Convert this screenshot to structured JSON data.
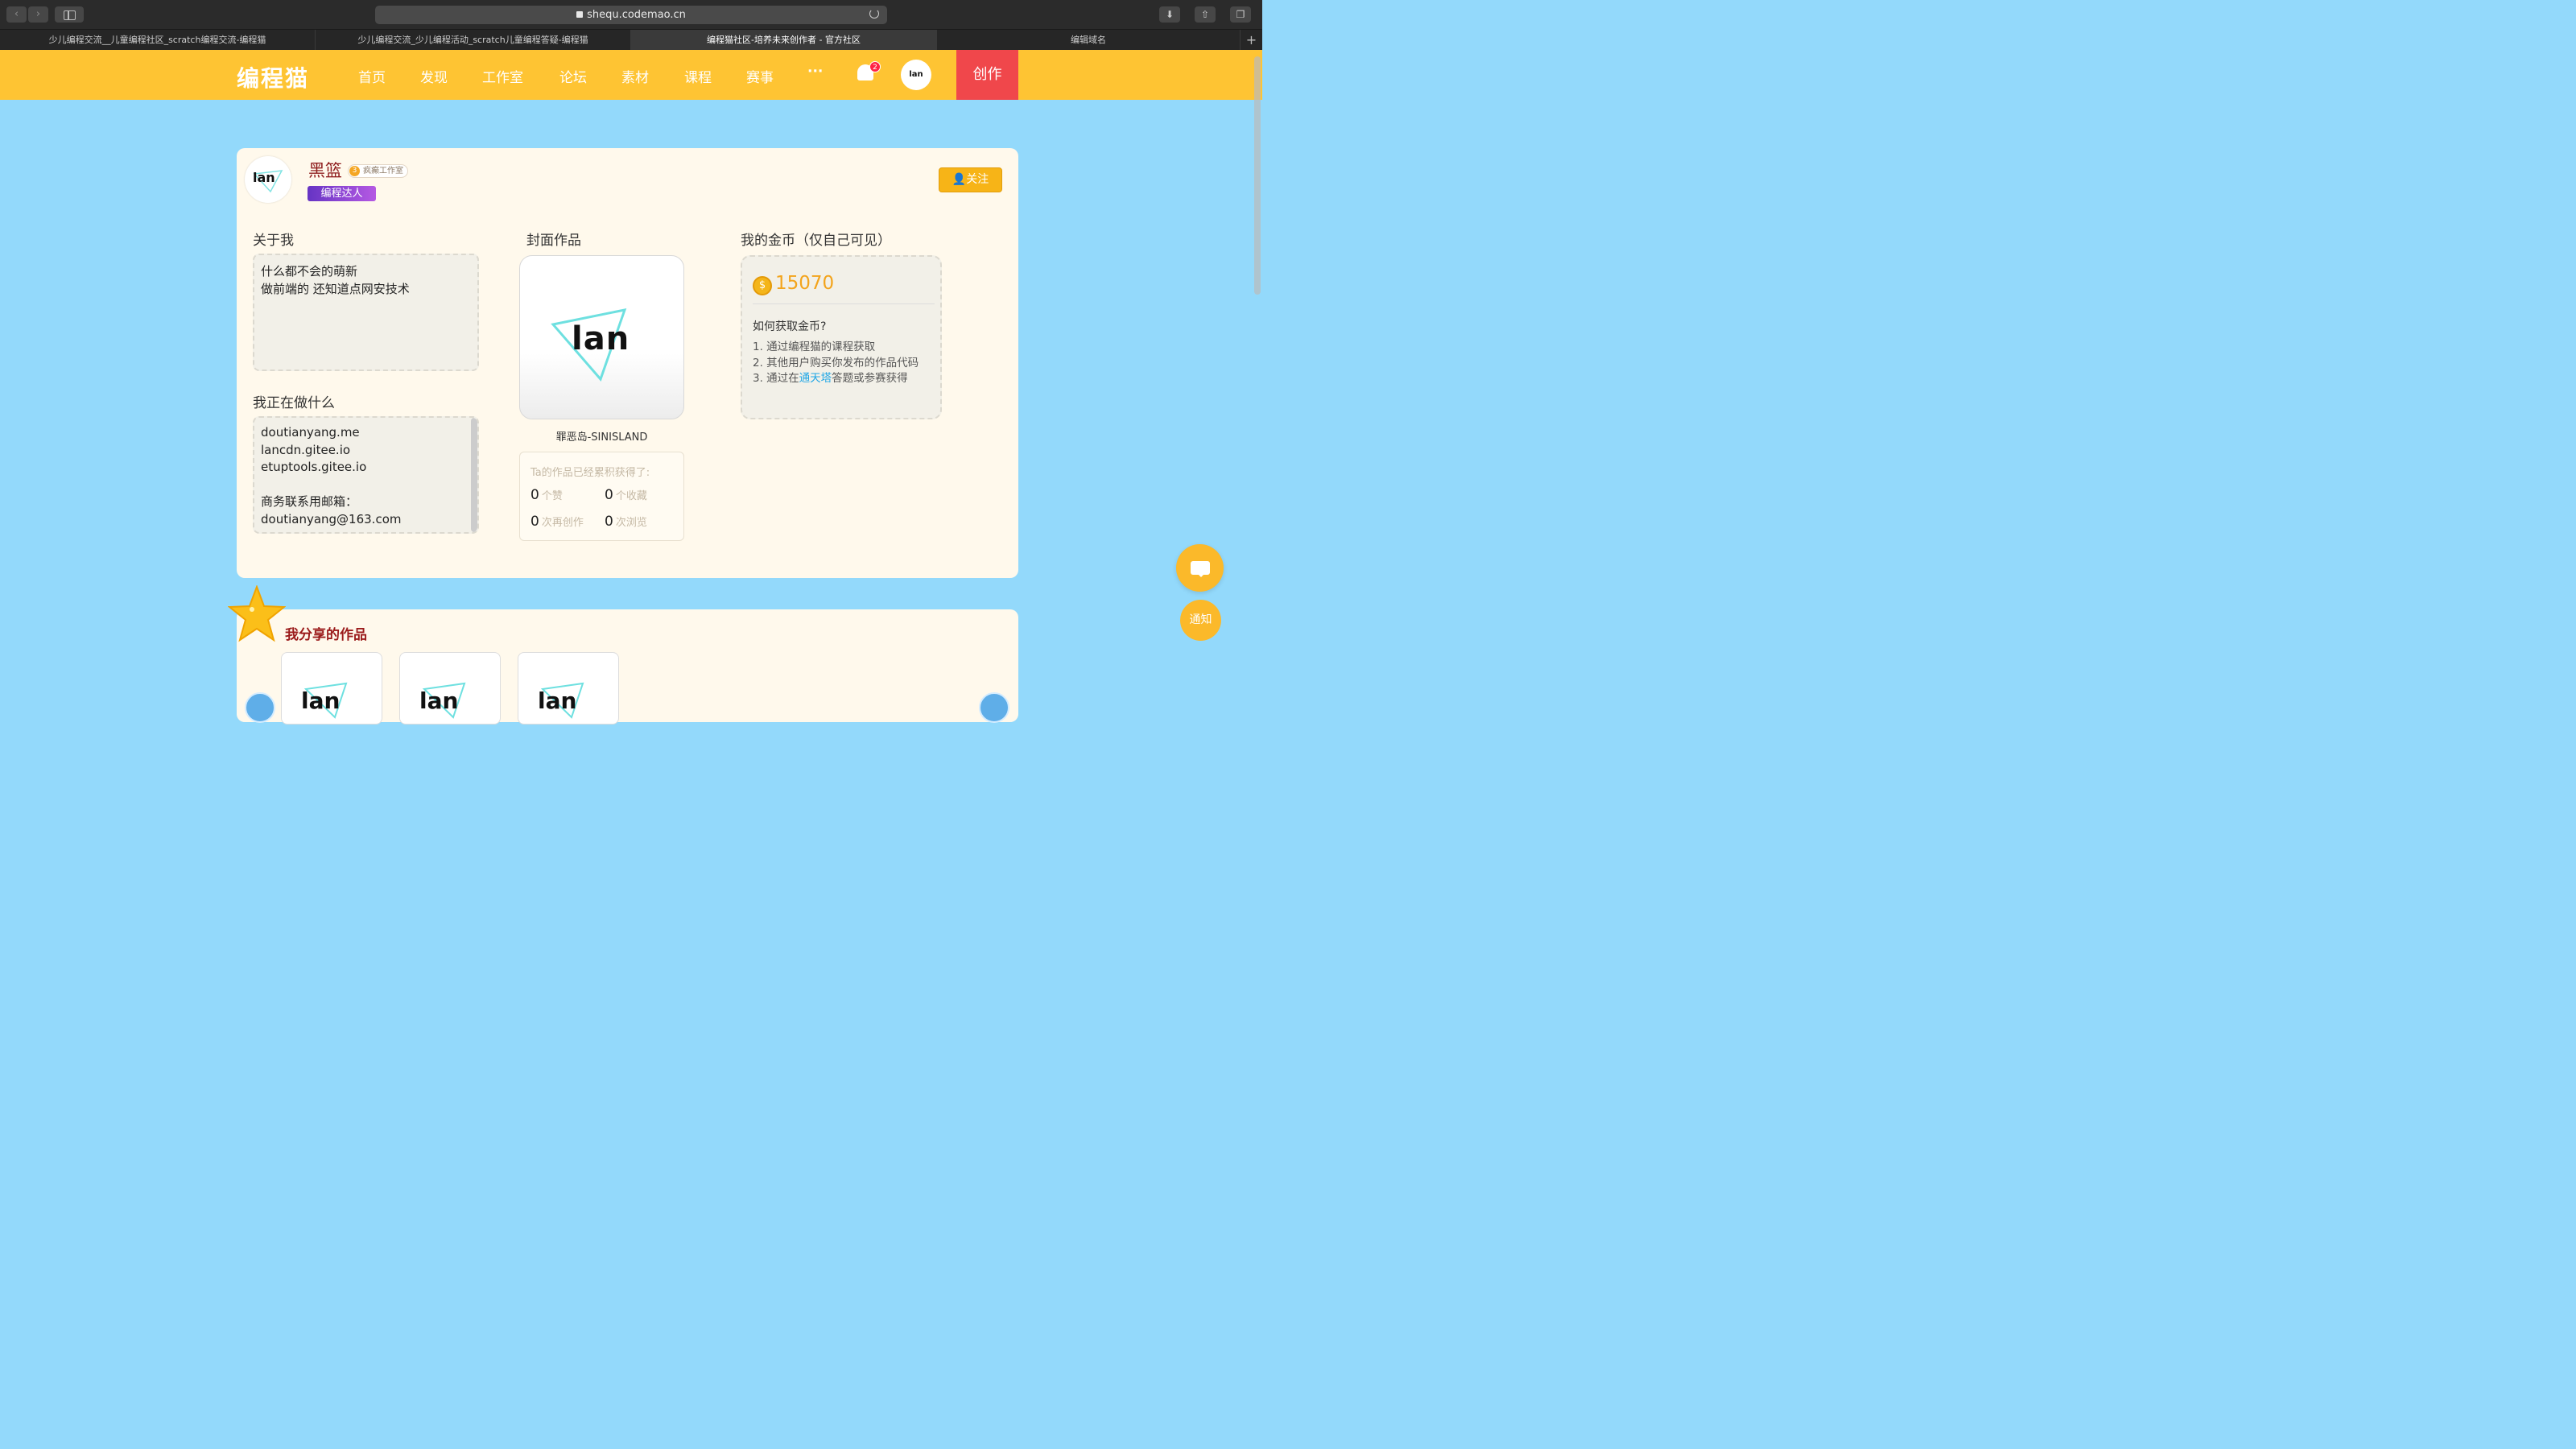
{
  "browser": {
    "url": "shequ.codemao.cn",
    "back_icon": "chevron-left-icon",
    "forward_icon": "chevron-right-icon",
    "tabs": [
      {
        "title": "少儿编程交流__儿童编程社区_scratch编程交流-编程猫",
        "active": false
      },
      {
        "title": "少儿编程交流_少儿编程活动_scratch儿童编程答疑-编程猫",
        "active": false
      },
      {
        "title": "编程猫社区-培养未来创作者 - 官方社区",
        "active": true
      },
      {
        "title": "编辑域名",
        "active": false
      }
    ],
    "new_tab": "+"
  },
  "header": {
    "logo": "编程猫",
    "nav": [
      "首页",
      "发现",
      "工作室",
      "论坛",
      "素材",
      "课程",
      "赛事",
      "···"
    ],
    "notification_count": "2",
    "avatar_text": "lan",
    "create_label": "创作",
    "accent_color": "#fec433",
    "create_color": "#f0474b"
  },
  "profile": {
    "avatar_text": "lan",
    "username": "黑篮",
    "studio_level": "3",
    "studio_name": "疯癫工作室",
    "badge": "编程达人",
    "follow_label": "关注"
  },
  "about": {
    "title": "关于我",
    "lines": [
      "什么都不会的萌新",
      "做前端的 还知道点网安技术"
    ]
  },
  "doing": {
    "title": "我正在做什么",
    "lines": [
      "doutianyang.me",
      "lancdn.gitee.io",
      "etuptools.gitee.io",
      "",
      "商务联系用邮箱：",
      "doutianyang@163.com"
    ]
  },
  "cover": {
    "title": "封面作品",
    "image_text": "lan",
    "name": "罪恶岛-SINISLAND",
    "stats_head": "Ta的作品已经累积获得了:",
    "likes": "0",
    "likes_label": "个赞",
    "collects": "0",
    "collects_label": "个收藏",
    "recreates": "0",
    "recreates_label": "次再创作",
    "views": "0",
    "views_label": "次浏览"
  },
  "coins": {
    "title": "我的金币（仅自己可见）",
    "amount": "15070",
    "how_title": "如何获取金币?",
    "item1": "1. 通过编程猫的课程获取",
    "item2": "2. 其他用户购买你发布的作品代码",
    "item3_pre": "3. 通过在",
    "item3_link": "通天塔",
    "item3_post": "答题或参赛获得"
  },
  "shared": {
    "title": "我分享的作品",
    "works": [
      "lan",
      "lan",
      "lan"
    ]
  },
  "floating": {
    "chat_icon": "chat-bubble-icon",
    "notice_label": "通知"
  }
}
